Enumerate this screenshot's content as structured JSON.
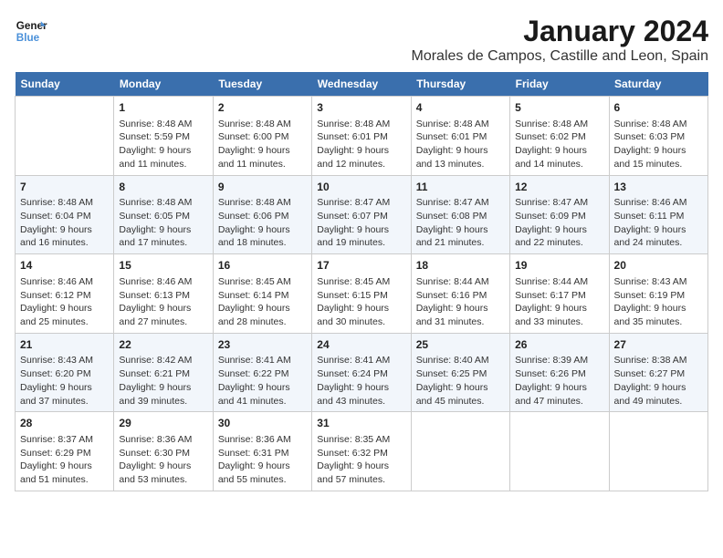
{
  "header": {
    "logo_line1": "General",
    "logo_line2": "Blue",
    "month": "January 2024",
    "location": "Morales de Campos, Castille and Leon, Spain"
  },
  "weekdays": [
    "Sunday",
    "Monday",
    "Tuesday",
    "Wednesday",
    "Thursday",
    "Friday",
    "Saturday"
  ],
  "weeks": [
    [
      {
        "day": null
      },
      {
        "day": "1",
        "sunrise": "Sunrise: 8:48 AM",
        "sunset": "Sunset: 5:59 PM",
        "daylight": "Daylight: 9 hours and 11 minutes."
      },
      {
        "day": "2",
        "sunrise": "Sunrise: 8:48 AM",
        "sunset": "Sunset: 6:00 PM",
        "daylight": "Daylight: 9 hours and 11 minutes."
      },
      {
        "day": "3",
        "sunrise": "Sunrise: 8:48 AM",
        "sunset": "Sunset: 6:01 PM",
        "daylight": "Daylight: 9 hours and 12 minutes."
      },
      {
        "day": "4",
        "sunrise": "Sunrise: 8:48 AM",
        "sunset": "Sunset: 6:01 PM",
        "daylight": "Daylight: 9 hours and 13 minutes."
      },
      {
        "day": "5",
        "sunrise": "Sunrise: 8:48 AM",
        "sunset": "Sunset: 6:02 PM",
        "daylight": "Daylight: 9 hours and 14 minutes."
      },
      {
        "day": "6",
        "sunrise": "Sunrise: 8:48 AM",
        "sunset": "Sunset: 6:03 PM",
        "daylight": "Daylight: 9 hours and 15 minutes."
      }
    ],
    [
      {
        "day": "7",
        "sunrise": "Sunrise: 8:48 AM",
        "sunset": "Sunset: 6:04 PM",
        "daylight": "Daylight: 9 hours and 16 minutes."
      },
      {
        "day": "8",
        "sunrise": "Sunrise: 8:48 AM",
        "sunset": "Sunset: 6:05 PM",
        "daylight": "Daylight: 9 hours and 17 minutes."
      },
      {
        "day": "9",
        "sunrise": "Sunrise: 8:48 AM",
        "sunset": "Sunset: 6:06 PM",
        "daylight": "Daylight: 9 hours and 18 minutes."
      },
      {
        "day": "10",
        "sunrise": "Sunrise: 8:47 AM",
        "sunset": "Sunset: 6:07 PM",
        "daylight": "Daylight: 9 hours and 19 minutes."
      },
      {
        "day": "11",
        "sunrise": "Sunrise: 8:47 AM",
        "sunset": "Sunset: 6:08 PM",
        "daylight": "Daylight: 9 hours and 21 minutes."
      },
      {
        "day": "12",
        "sunrise": "Sunrise: 8:47 AM",
        "sunset": "Sunset: 6:09 PM",
        "daylight": "Daylight: 9 hours and 22 minutes."
      },
      {
        "day": "13",
        "sunrise": "Sunrise: 8:46 AM",
        "sunset": "Sunset: 6:11 PM",
        "daylight": "Daylight: 9 hours and 24 minutes."
      }
    ],
    [
      {
        "day": "14",
        "sunrise": "Sunrise: 8:46 AM",
        "sunset": "Sunset: 6:12 PM",
        "daylight": "Daylight: 9 hours and 25 minutes."
      },
      {
        "day": "15",
        "sunrise": "Sunrise: 8:46 AM",
        "sunset": "Sunset: 6:13 PM",
        "daylight": "Daylight: 9 hours and 27 minutes."
      },
      {
        "day": "16",
        "sunrise": "Sunrise: 8:45 AM",
        "sunset": "Sunset: 6:14 PM",
        "daylight": "Daylight: 9 hours and 28 minutes."
      },
      {
        "day": "17",
        "sunrise": "Sunrise: 8:45 AM",
        "sunset": "Sunset: 6:15 PM",
        "daylight": "Daylight: 9 hours and 30 minutes."
      },
      {
        "day": "18",
        "sunrise": "Sunrise: 8:44 AM",
        "sunset": "Sunset: 6:16 PM",
        "daylight": "Daylight: 9 hours and 31 minutes."
      },
      {
        "day": "19",
        "sunrise": "Sunrise: 8:44 AM",
        "sunset": "Sunset: 6:17 PM",
        "daylight": "Daylight: 9 hours and 33 minutes."
      },
      {
        "day": "20",
        "sunrise": "Sunrise: 8:43 AM",
        "sunset": "Sunset: 6:19 PM",
        "daylight": "Daylight: 9 hours and 35 minutes."
      }
    ],
    [
      {
        "day": "21",
        "sunrise": "Sunrise: 8:43 AM",
        "sunset": "Sunset: 6:20 PM",
        "daylight": "Daylight: 9 hours and 37 minutes."
      },
      {
        "day": "22",
        "sunrise": "Sunrise: 8:42 AM",
        "sunset": "Sunset: 6:21 PM",
        "daylight": "Daylight: 9 hours and 39 minutes."
      },
      {
        "day": "23",
        "sunrise": "Sunrise: 8:41 AM",
        "sunset": "Sunset: 6:22 PM",
        "daylight": "Daylight: 9 hours and 41 minutes."
      },
      {
        "day": "24",
        "sunrise": "Sunrise: 8:41 AM",
        "sunset": "Sunset: 6:24 PM",
        "daylight": "Daylight: 9 hours and 43 minutes."
      },
      {
        "day": "25",
        "sunrise": "Sunrise: 8:40 AM",
        "sunset": "Sunset: 6:25 PM",
        "daylight": "Daylight: 9 hours and 45 minutes."
      },
      {
        "day": "26",
        "sunrise": "Sunrise: 8:39 AM",
        "sunset": "Sunset: 6:26 PM",
        "daylight": "Daylight: 9 hours and 47 minutes."
      },
      {
        "day": "27",
        "sunrise": "Sunrise: 8:38 AM",
        "sunset": "Sunset: 6:27 PM",
        "daylight": "Daylight: 9 hours and 49 minutes."
      }
    ],
    [
      {
        "day": "28",
        "sunrise": "Sunrise: 8:37 AM",
        "sunset": "Sunset: 6:29 PM",
        "daylight": "Daylight: 9 hours and 51 minutes."
      },
      {
        "day": "29",
        "sunrise": "Sunrise: 8:36 AM",
        "sunset": "Sunset: 6:30 PM",
        "daylight": "Daylight: 9 hours and 53 minutes."
      },
      {
        "day": "30",
        "sunrise": "Sunrise: 8:36 AM",
        "sunset": "Sunset: 6:31 PM",
        "daylight": "Daylight: 9 hours and 55 minutes."
      },
      {
        "day": "31",
        "sunrise": "Sunrise: 8:35 AM",
        "sunset": "Sunset: 6:32 PM",
        "daylight": "Daylight: 9 hours and 57 minutes."
      },
      {
        "day": null
      },
      {
        "day": null
      },
      {
        "day": null
      }
    ]
  ]
}
